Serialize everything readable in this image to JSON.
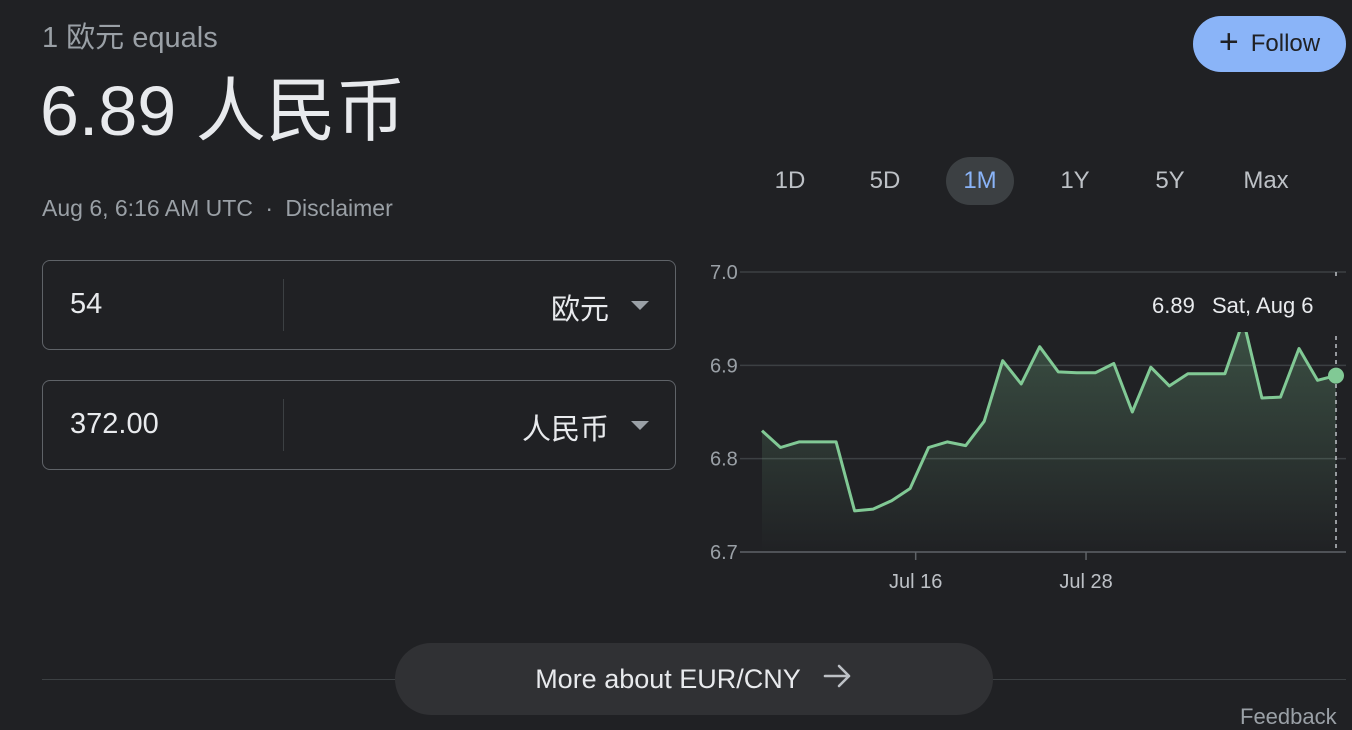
{
  "header": {
    "equals_line": "1 欧元 equals",
    "rate": "6.89 人民币",
    "timestamp": "Aug 6, 6:16 AM UTC",
    "separator": "·",
    "disclaimer": "Disclaimer",
    "follow_label": "Follow"
  },
  "converter": {
    "from": {
      "value": "54",
      "currency": "欧元"
    },
    "to": {
      "value": "372.00",
      "currency": "人民币"
    }
  },
  "ranges": [
    "1D",
    "5D",
    "1M",
    "1Y",
    "5Y",
    "Max"
  ],
  "active_range": "1M",
  "tooltip": {
    "value": "6.89",
    "date": "Sat, Aug 6"
  },
  "colors": {
    "accent": "#8ab4f8",
    "line": "#81c995",
    "background": "#202124"
  },
  "chart_data": {
    "type": "line",
    "y_ticks": [
      "7.0",
      "6.9",
      "6.8",
      "6.7"
    ],
    "x_ticks": [
      "Jul 16",
      "Jul 28"
    ],
    "ylim": [
      6.7,
      7.0
    ],
    "grid": true,
    "values": [
      6.83,
      6.812,
      6.818,
      6.818,
      6.818,
      6.744,
      6.746,
      6.755,
      6.768,
      6.812,
      6.818,
      6.814,
      6.84,
      6.905,
      6.88,
      6.92,
      6.893,
      6.892,
      6.892,
      6.902,
      6.85,
      6.898,
      6.878,
      6.891,
      6.891,
      6.891,
      6.948,
      6.865,
      6.866,
      6.918,
      6.884,
      6.889
    ]
  },
  "more_label": "More about EUR/CNY",
  "feedback": "Feedback"
}
